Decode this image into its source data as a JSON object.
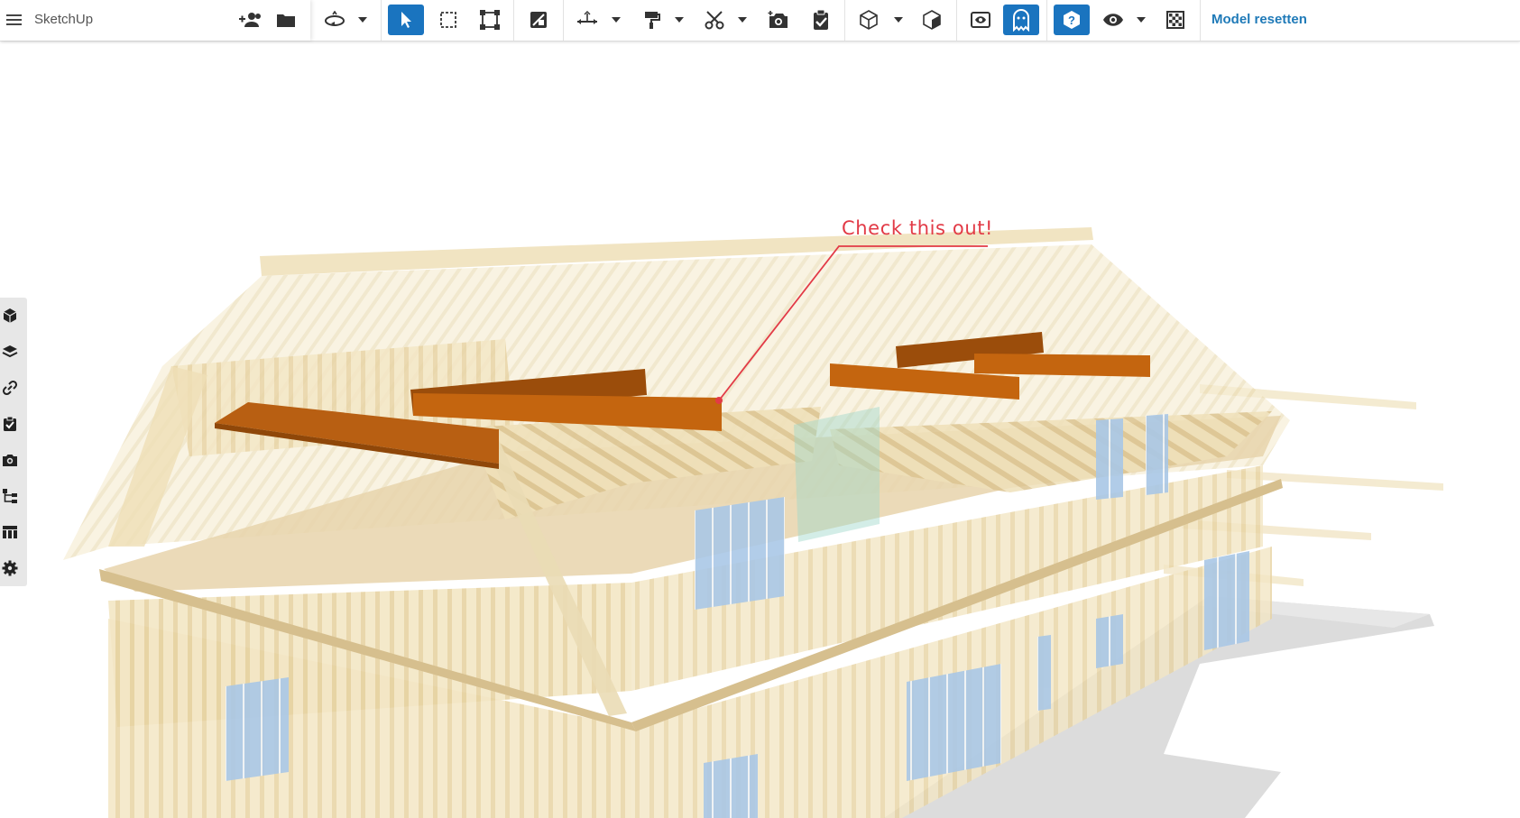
{
  "app": {
    "title": "SketchUp"
  },
  "toolbar": {
    "reset_label": "Model resetten",
    "accent_color": "#1a74bf",
    "tools": [
      {
        "icon": "add-user-icon"
      },
      {
        "icon": "folder-icon"
      },
      {
        "icon": "orbit-icon",
        "has_dropdown": true
      },
      {
        "icon": "select-arrow-icon",
        "active": true
      },
      {
        "icon": "selection-box-icon"
      },
      {
        "icon": "scale-bounding-icon"
      },
      {
        "icon": "section-plane-icon"
      },
      {
        "icon": "dimension-icon",
        "has_dropdown": true
      },
      {
        "icon": "paint-roller-icon",
        "has_dropdown": true
      },
      {
        "icon": "scissors-icon",
        "has_dropdown": true
      },
      {
        "icon": "camera-plus-icon"
      },
      {
        "icon": "clipboard-check-icon"
      },
      {
        "icon": "cube-icon",
        "has_dropdown": true
      },
      {
        "icon": "box-view-icon"
      },
      {
        "icon": "xray-icon"
      },
      {
        "icon": "ghost-icon",
        "active": true
      },
      {
        "icon": "help-icon",
        "active": true
      },
      {
        "icon": "eye-icon",
        "has_dropdown": true
      },
      {
        "icon": "checkerboard-icon"
      }
    ]
  },
  "sidebar": {
    "items": [
      {
        "icon": "component-cube-icon"
      },
      {
        "icon": "layers-icon"
      },
      {
        "icon": "link-icon"
      },
      {
        "icon": "clipboard-check-icon"
      },
      {
        "icon": "camera-icon"
      },
      {
        "icon": "hierarchy-icon"
      },
      {
        "icon": "table-icon"
      },
      {
        "icon": "settings-gear-icon"
      }
    ]
  },
  "viewport": {
    "annotation": {
      "text": "Check this out!",
      "color": "#e23a46"
    }
  }
}
